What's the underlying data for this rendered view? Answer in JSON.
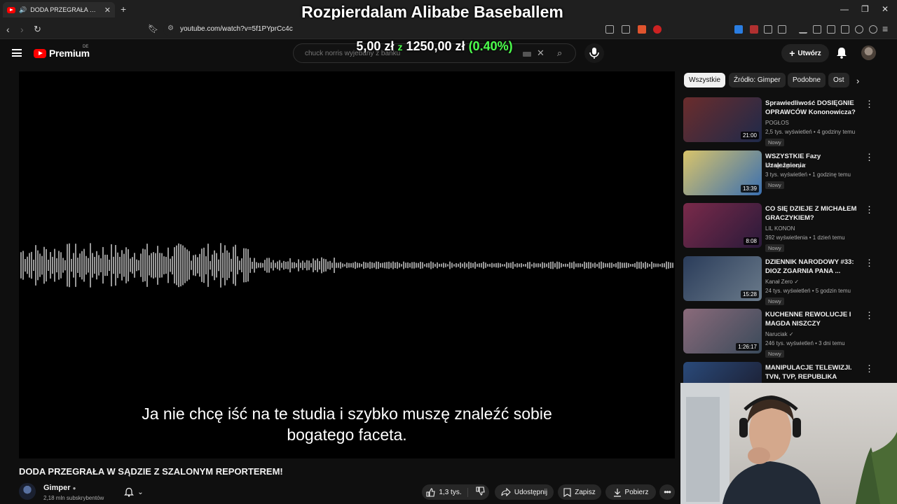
{
  "browser": {
    "tab_title": "DODA PRZEGRAŁA W SĄDZIE Z",
    "url": "youtube.com/watch?v=5f1PYprCc4c"
  },
  "overlay": {
    "stream_title": "Rozpierdalam Alibabe Baseballem",
    "donation_amount": "5,00 zł",
    "donation_of": "z",
    "donation_goal": "1250,00 zł",
    "donation_percent": "(0.40%)"
  },
  "header": {
    "logo_text": "Premium",
    "country_code": "DE",
    "search_value": "chuck norris wyjebany z banku",
    "create_label": "Utwórz"
  },
  "player": {
    "subtitle_line1": "Ja nie chcę iść na te studia i szybko muszę znaleźć sobie",
    "subtitle_line2": "bogatego faceta."
  },
  "video": {
    "title": "DODA PRZEGRAŁA W SĄDZIE Z SZALONYM REPORTEREM!",
    "channel": "Gimper",
    "subscribers": "2,18 mln subskrybentów",
    "likes": "1,3 tys.",
    "share_label": "Udostępnij",
    "save_label": "Zapisz",
    "download_label": "Pobierz"
  },
  "chips": [
    "Wszystkie",
    "Źródło: Gimper",
    "Podobne",
    "Ost"
  ],
  "recommendations": [
    {
      "title": "Sprawiedliwość DOSIĘGNIE OPRAWCÓW Kononowicza? ...",
      "channel": "POGŁOS",
      "meta": "2,5 tys. wyświetleń • 4 godziny temu",
      "badge": "Nowy",
      "duration": "21:00",
      "verified": false
    },
    {
      "title": "WSZYSTKIE Fazy Uzależnienia",
      "channel": "Kolega Ignacy",
      "meta": "3 tys. wyświetleń • 1 godzinę temu",
      "badge": "Nowy",
      "duration": "13:39",
      "verified": true
    },
    {
      "title": "CO SIĘ DZIEJE Z MICHAŁEM GRACZYKIEM?",
      "channel": "LIL KONON",
      "meta": "392 wyświetlenia • 1 dzień temu",
      "badge": "Nowy",
      "duration": "8:08",
      "verified": false
    },
    {
      "title": "DZIENNIK NARODOWY #33: DIOZ ZGARNIA PANA ...",
      "channel": "Kanał Zero",
      "meta": "24 tys. wyświetleń • 5 godzin temu",
      "badge": "Nowy",
      "duration": "15:28",
      "verified": true
    },
    {
      "title": "KUCHENNE REWOLUCJE I MAGDA NISZCZY PSYCHICZN...",
      "channel": "Naruciak",
      "meta": "246 tys. wyświetleń • 3 dni temu",
      "badge": "Nowy",
      "duration": "1:26:17",
      "verified": true
    },
    {
      "title": "MANIPULACJE TELEWIZJI. TVN, TVP, REPUBLIKA",
      "channel": "Kanał Zero",
      "meta": "",
      "badge": "",
      "duration": "",
      "verified": true
    }
  ],
  "colors": {
    "youtube_red": "#ff0000",
    "donation_green": "#4cff4c",
    "background": "#0f0f0f"
  }
}
